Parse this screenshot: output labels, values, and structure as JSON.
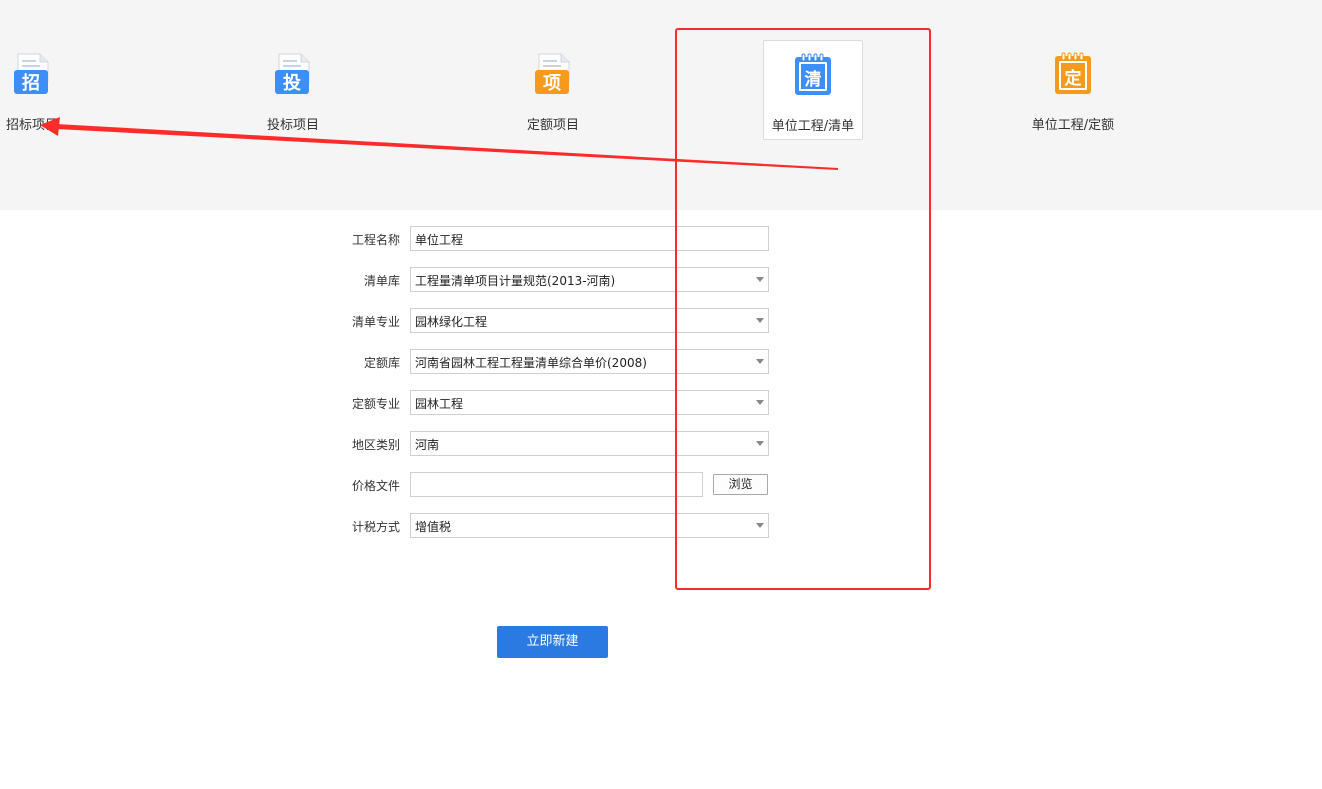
{
  "project_types": [
    {
      "label": "招标项目",
      "icon_char": "招",
      "icon": "document-blue-icon",
      "color": "#3d8ef6"
    },
    {
      "label": "投标项目",
      "icon_char": "投",
      "icon": "document-blue-icon",
      "color": "#3d8ef6"
    },
    {
      "label": "定额项目",
      "icon_char": "项",
      "icon": "document-orange-icon",
      "color": "#f59a1d"
    },
    {
      "label": "单位工程/清单",
      "icon_char": "清",
      "icon": "notepad-blue-icon",
      "color": "#3d8ef6",
      "selected": true
    },
    {
      "label": "单位工程/定额",
      "icon_char": "定",
      "icon": "notepad-orange-icon",
      "color": "#f59a1d"
    }
  ],
  "form": {
    "project_name": {
      "label": "工程名称",
      "value": "单位工程"
    },
    "bill_library": {
      "label": "清单库",
      "value": "工程量清单项目计量规范(2013-河南)"
    },
    "bill_specialty": {
      "label": "清单专业",
      "value": "园林绿化工程"
    },
    "quota_library": {
      "label": "定额库",
      "value": "河南省园林工程工程量清单综合单价(2008)"
    },
    "quota_specialty": {
      "label": "定额专业",
      "value": "园林工程"
    },
    "region": {
      "label": "地区类别",
      "value": "河南"
    },
    "price_file": {
      "label": "价格文件",
      "value": "",
      "browse_label": "浏览"
    },
    "tax_method": {
      "label": "计税方式",
      "value": "增值税"
    }
  },
  "submit_label": "立即新建",
  "colors": {
    "accent": "#2a7ae2",
    "annotation": "#ff2a2a",
    "top_bg": "#f5f5f5"
  }
}
